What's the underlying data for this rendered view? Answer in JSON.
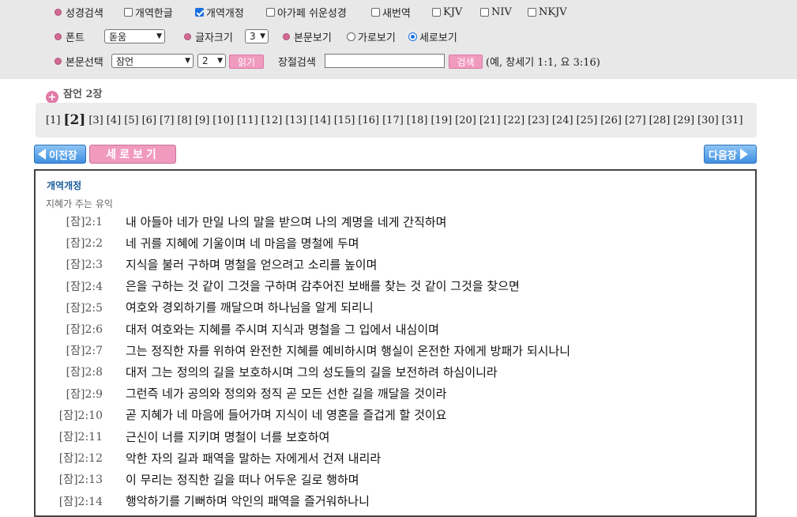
{
  "toolbar": {
    "row1": [
      {
        "type": "bullet-label",
        "label": "성경검색"
      },
      {
        "type": "checkbox",
        "label": "개역한글",
        "checked": false
      },
      {
        "type": "checkbox",
        "label": "개역개정",
        "checked": true
      },
      {
        "type": "checkbox",
        "label": "아가페 쉬운성경",
        "checked": false
      },
      {
        "type": "checkbox",
        "label": "새번역",
        "checked": false
      },
      {
        "type": "checkbox",
        "label": "KJV",
        "checked": false
      },
      {
        "type": "checkbox",
        "label": "NIV",
        "checked": false
      },
      {
        "type": "checkbox",
        "label": "NKJV",
        "checked": false
      }
    ],
    "font_label": "폰트",
    "font_value": "돋움",
    "size_label": "글자크기",
    "size_value": "3",
    "view_label": "본문보기",
    "view_horizontal": "가로보기",
    "view_vertical": "세로보기",
    "view_selected": "세로보기",
    "select_label": "본문선택",
    "book_value": "잠언",
    "chapter_value": "2",
    "read_button": "읽기",
    "search_label": "장절검색",
    "search_value": "",
    "search_button": "검색",
    "search_hint": "(예, 창세기 1:1, 요 3:16)"
  },
  "breadcrumb": "잠언 2장",
  "chapters": [
    "[1]",
    "[2]",
    "[3]",
    "[4]",
    "[5]",
    "[6]",
    "[7]",
    "[8]",
    "[9]",
    "[10]",
    "[11]",
    "[12]",
    "[13]",
    "[14]",
    "[15]",
    "[16]",
    "[17]",
    "[18]",
    "[19]",
    "[20]",
    "[21]",
    "[22]",
    "[23]",
    "[24]",
    "[25]",
    "[26]",
    "[27]",
    "[28]",
    "[29]",
    "[30]",
    "[31]"
  ],
  "current_chapter_index": 1,
  "nav": {
    "prev": "이전장",
    "next": "다음장",
    "view_mode": "세로보기"
  },
  "passage": {
    "version": "개역개정",
    "heading": "지혜가 주는 유익",
    "verses": [
      {
        "ref": "[잠]2:1",
        "text": "내 아들아 네가 만일 나의 말을 받으며 나의 계명을 네게 간직하며"
      },
      {
        "ref": "[잠]2:2",
        "text": "네 귀를 지혜에 기울이며 네 마음을 명철에 두며"
      },
      {
        "ref": "[잠]2:3",
        "text": "지식을 불러 구하며 명철을 얻으려고 소리를 높이며"
      },
      {
        "ref": "[잠]2:4",
        "text": "은을 구하는 것 같이 그것을 구하며 감추어진 보배를 찾는 것 같이 그것을 찾으면"
      },
      {
        "ref": "[잠]2:5",
        "text": "여호와 경외하기를 깨달으며 하나님을 알게 되리니"
      },
      {
        "ref": "[잠]2:6",
        "text": "대저 여호와는 지혜를 주시며 지식과 명철을 그 입에서 내심이며"
      },
      {
        "ref": "[잠]2:7",
        "text": "그는 정직한 자를 위하여 완전한 지혜를 예비하시며 행실이 온전한 자에게 방패가 되시나니"
      },
      {
        "ref": "[잠]2:8",
        "text": "대저 그는 정의의 길을 보호하시며 그의 성도들의 길을 보전하려 하심이니라"
      },
      {
        "ref": "[잠]2:9",
        "text": "그런즉 네가 공의와 정의와 정직 곧 모든 선한 길을 깨달을 것이라"
      },
      {
        "ref": "[잠]2:10",
        "text": "곧 지혜가 네 마음에 들어가며 지식이 네 영혼을 즐겁게 할 것이요"
      },
      {
        "ref": "[잠]2:11",
        "text": "근신이 너를 지키며 명철이 너를 보호하여"
      },
      {
        "ref": "[잠]2:12",
        "text": "악한 자의 길과 패역을 말하는 자에게서 건져 내리라"
      },
      {
        "ref": "[잠]2:13",
        "text": "이 무리는 정직한 길을 떠나 어두운 길로 행하며"
      },
      {
        "ref": "[잠]2:14",
        "text": "행악하기를 기뻐하며 악인의 패역을 즐거워하나니"
      }
    ]
  }
}
